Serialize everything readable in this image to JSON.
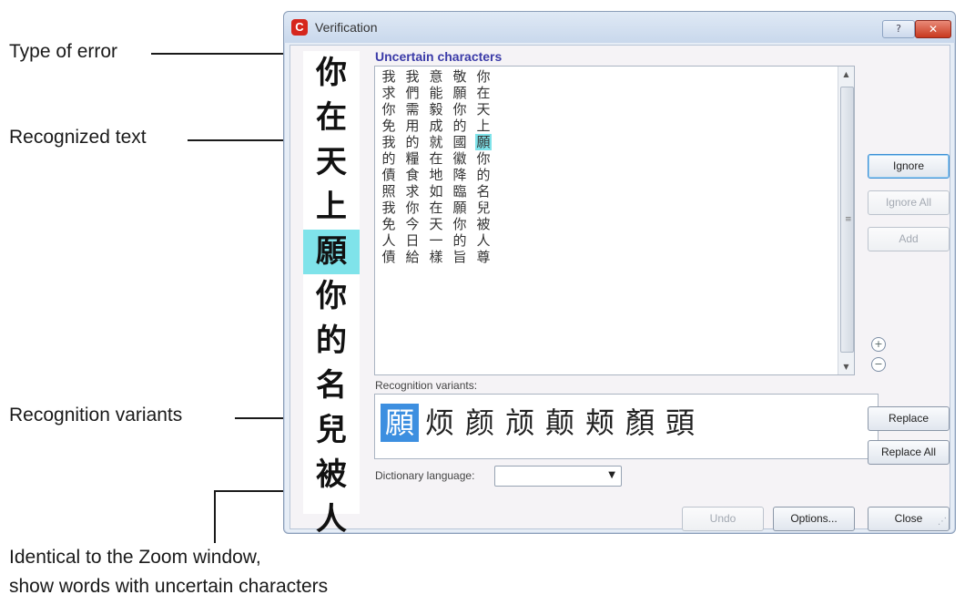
{
  "callouts": {
    "type_of_error": "Type of error",
    "recognized_text": "Recognized text",
    "recognition_variants": "Recognition variants",
    "note_line1": "Identical to the Zoom window,",
    "note_line2": "show words with uncertain characters"
  },
  "window": {
    "title": "Verification",
    "help_icon": "?",
    "close_icon": "✕"
  },
  "zoom_chars": [
    "你",
    "在",
    "天",
    "上",
    "願",
    "你",
    "的",
    "名",
    "兒",
    "被",
    "人"
  ],
  "error_type": "Uncertain characters",
  "recognized_columns": [
    "你在天上願你的名兒被人尊",
    "敬願你的國徽降臨願你的旨",
    "意能毅成就在地如在天一樣",
    "我們需用的糧食求你今日給",
    "我求你免我的債照我免人債"
  ],
  "variants_label": "Recognition variants:",
  "variants": [
    "願",
    "烦",
    "颜",
    "颃",
    "颠",
    "颊",
    "顏",
    "頭"
  ],
  "dictionary_label": "Dictionary language:",
  "dictionary_value": "",
  "buttons": {
    "ignore": "Ignore",
    "ignore_all": "Ignore All",
    "add": "Add",
    "replace": "Replace",
    "replace_all": "Replace All",
    "undo": "Undo",
    "options": "Options...",
    "close": "Close"
  },
  "colors": {
    "highlight": "#7fe3ea",
    "selected_variant": "#3d8fe0",
    "title_accent": "#3b3ba8"
  }
}
